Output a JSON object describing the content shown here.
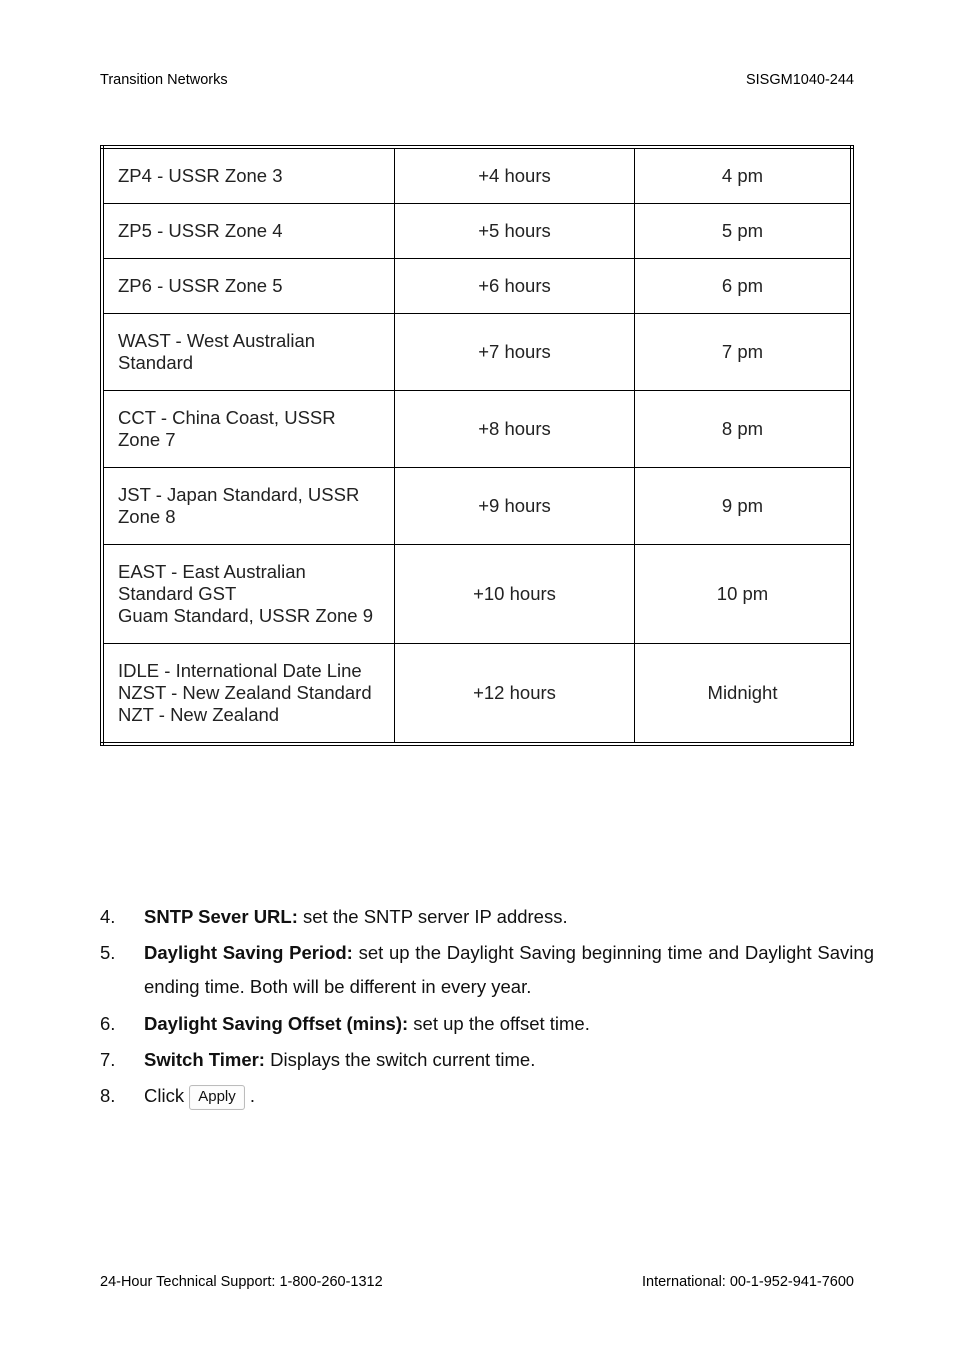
{
  "header": {
    "left": "Transition Networks",
    "right": "SISGM1040-244"
  },
  "table": {
    "rows": [
      {
        "zone": "ZP4 - USSR Zone 3",
        "offset": "+4 hours",
        "time": "4 pm"
      },
      {
        "zone": "ZP5 - USSR Zone 4",
        "offset": "+5 hours",
        "time": "5 pm"
      },
      {
        "zone": "ZP6 - USSR Zone 5",
        "offset": "+6 hours",
        "time": "6 pm"
      },
      {
        "zone": "WAST - West Australian Standard",
        "offset": "+7 hours",
        "time": "7 pm"
      },
      {
        "zone": "CCT - China Coast, USSR Zone 7",
        "offset": "+8 hours",
        "time": "8 pm"
      },
      {
        "zone": "JST - Japan Standard, USSR Zone 8",
        "offset": "+9 hours",
        "time": "9 pm"
      },
      {
        "zone": "EAST - East Australian Standard GST\nGuam Standard, USSR Zone 9",
        "offset": "+10 hours",
        "time": "10 pm"
      },
      {
        "zone": "IDLE - International Date Line\nNZST - New Zealand Standard\nNZT - New Zealand",
        "offset": "+12 hours",
        "time": "Midnight"
      }
    ]
  },
  "list": {
    "items": [
      {
        "bold": "SNTP Sever URL:",
        "text": " set the SNTP server IP address."
      },
      {
        "bold": "Daylight Saving Period:",
        "text": " set up the Daylight Saving beginning time and Daylight Saving ending time. Both will be different in every year.",
        "justify": true
      },
      {
        "bold": "Daylight Saving Offset (mins):",
        "text": " set up the offset time."
      },
      {
        "bold": "Switch Timer:",
        "text": " Displays the switch current time."
      }
    ],
    "click_item": {
      "prefix": "Click",
      "button": "Apply",
      "suffix": "."
    }
  },
  "footer": {
    "left": "24-Hour Technical Support: 1-800-260-1312",
    "right": "International: 00-1-952-941-7600"
  }
}
